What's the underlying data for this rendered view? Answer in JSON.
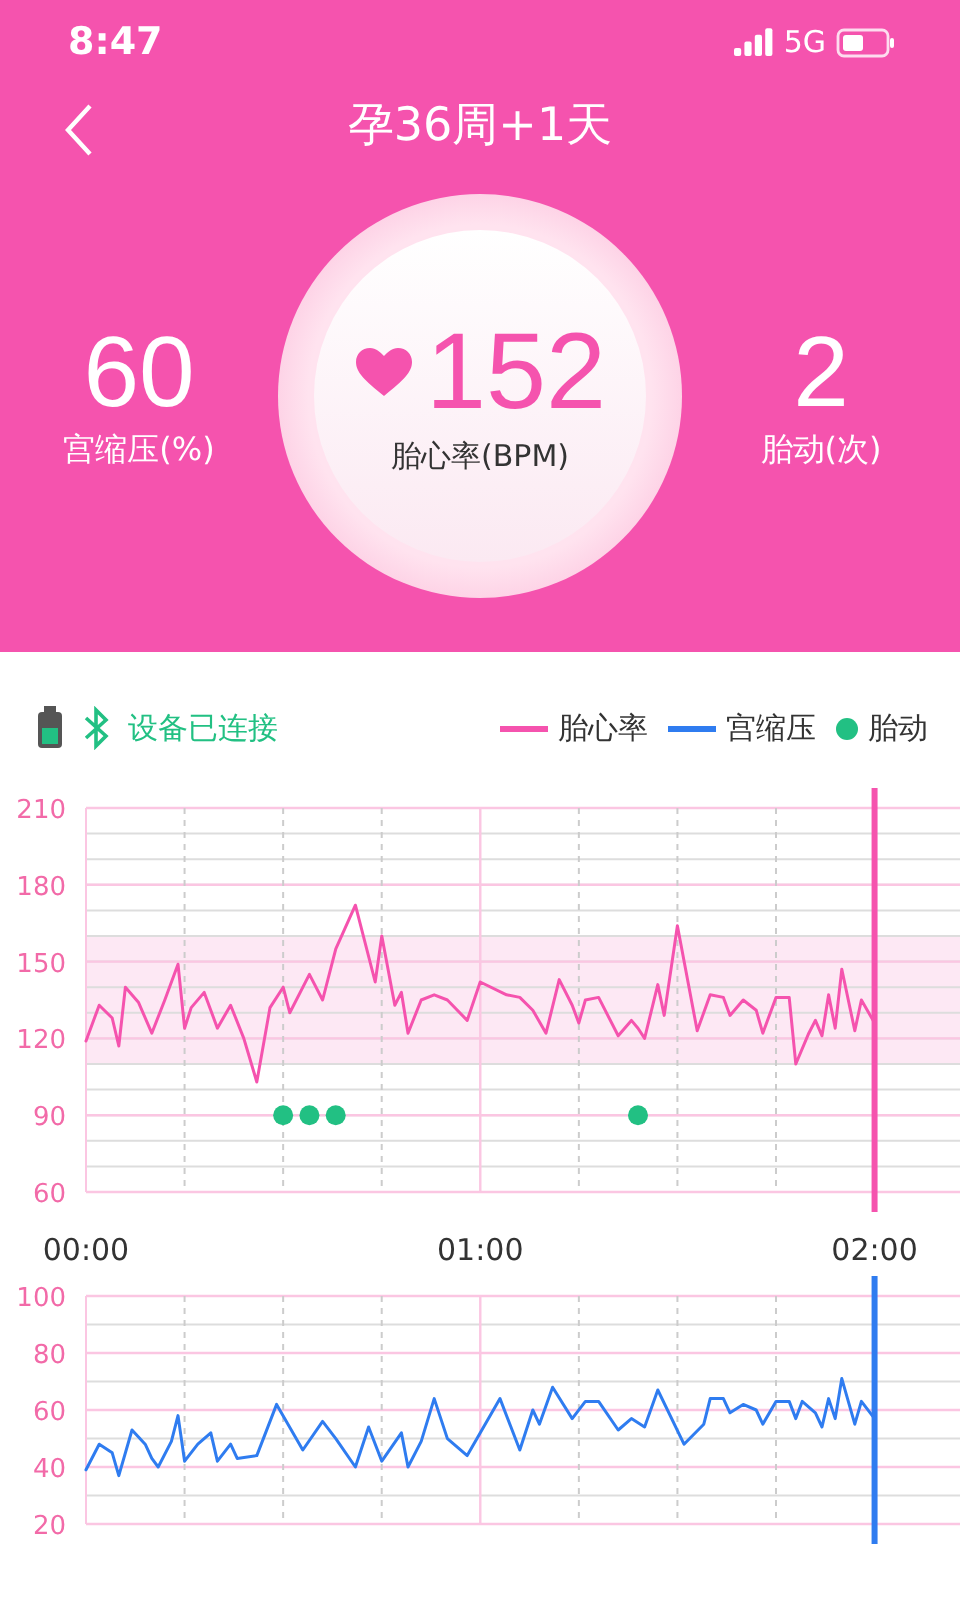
{
  "status_bar": {
    "time": "8:47",
    "network": "5G"
  },
  "header": {
    "title": "孕36周+1天"
  },
  "stats": [
    {
      "kind": "side",
      "value": "60",
      "label": "宫缩压(%)"
    },
    {
      "kind": "main",
      "value": "152",
      "label": "胎心率(BPM)"
    },
    {
      "kind": "side",
      "value": "2",
      "label": "胎动(次)"
    }
  ],
  "device": {
    "status": "设备已连接",
    "connected": true
  },
  "fhr_chart": {
    "chart_data": {
      "type": "line",
      "grid": true,
      "bands": [
        {
          "axis": "y",
          "from": 110,
          "to": 160,
          "color": "#fde8f4"
        }
      ],
      "ref_lines": [
        {
          "axis": "x",
          "value": 60,
          "color": "#fbc6e2"
        },
        {
          "axis": "x",
          "value": 120,
          "color": "#f553ae"
        }
      ],
      "xlim": [
        0,
        133
      ],
      "ylim": [
        60,
        210
      ],
      "yticks": [
        60,
        90,
        120,
        150,
        180,
        210
      ],
      "xticks": [
        {
          "value": 0,
          "label": "00:00"
        },
        {
          "value": 60,
          "label": "01:00"
        },
        {
          "value": 120,
          "label": "02:00"
        }
      ],
      "x": [
        0,
        2,
        4,
        5,
        6,
        8,
        10,
        12,
        14,
        15,
        16,
        18,
        20,
        22,
        24,
        26,
        28,
        30,
        31,
        34,
        36,
        38,
        41,
        44,
        45,
        47,
        48,
        49,
        51,
        53,
        55,
        58,
        60,
        64,
        66,
        68,
        70,
        72,
        74,
        75,
        76,
        78,
        81,
        83,
        84,
        85,
        87,
        88,
        90,
        93,
        95,
        97,
        98,
        100,
        102,
        103,
        105,
        107,
        108,
        110,
        111,
        112,
        113,
        114,
        115,
        117,
        118,
        120
      ],
      "series": [
        {
          "name": "胎心率",
          "color": "#f553ae",
          "values": [
            119,
            133,
            128,
            117,
            140,
            134,
            122,
            135,
            149,
            124,
            132,
            138,
            124,
            133,
            120,
            103,
            132,
            140,
            130,
            145,
            135,
            155,
            172,
            142,
            160,
            133,
            138,
            122,
            135,
            137,
            135,
            127,
            142,
            137,
            136,
            131,
            122,
            143,
            133,
            126,
            135,
            136,
            121,
            127,
            124,
            120,
            141,
            129,
            164,
            123,
            137,
            136,
            129,
            135,
            131,
            122,
            136,
            136,
            110,
            122,
            127,
            121,
            137,
            124,
            147,
            123,
            135,
            126
          ]
        },
        {
          "name": "胎动",
          "type": "scatter",
          "color": "#22c083",
          "values": [
            null,
            null,
            null,
            null,
            null,
            null,
            null,
            null,
            null,
            null,
            null,
            null,
            null,
            null,
            null,
            null,
            null,
            90,
            null,
            90,
            null,
            90,
            null,
            null,
            null,
            null,
            null,
            null,
            null,
            null,
            null,
            null,
            null,
            null,
            null,
            null,
            null,
            null,
            null,
            null,
            null,
            null,
            null,
            null,
            90,
            null,
            null,
            null,
            null,
            null,
            null,
            null,
            null,
            null,
            null,
            null,
            null,
            null,
            null,
            null,
            null,
            null,
            null,
            null,
            null,
            null,
            null,
            null
          ]
        }
      ]
    }
  },
  "toco_chart": {
    "chart_data": {
      "type": "line",
      "grid": true,
      "ref_lines": [
        {
          "axis": "x",
          "value": 60,
          "color": "#fbc6e2"
        },
        {
          "axis": "x",
          "value": 120,
          "color": "#2f7cf0"
        }
      ],
      "xlim": [
        0,
        133
      ],
      "ylim": [
        20,
        100
      ],
      "yticks": [
        20,
        40,
        60,
        80,
        100
      ],
      "x": [
        0,
        2,
        4,
        5,
        7,
        9,
        10,
        11,
        13,
        14,
        15,
        17,
        19,
        20,
        22,
        23,
        26,
        29,
        33,
        36,
        38,
        41,
        43,
        45,
        48,
        49,
        51,
        53,
        55,
        58,
        63,
        66,
        68,
        69,
        71,
        74,
        76,
        78,
        81,
        83,
        85,
        87,
        91,
        94,
        95,
        97,
        98,
        100,
        102,
        103,
        105,
        107,
        108,
        109,
        111,
        112,
        113,
        114,
        115,
        117,
        118,
        120
      ],
      "series": [
        {
          "name": "宫缩压",
          "color": "#2f7cf0",
          "values": [
            39,
            48,
            45,
            37,
            53,
            48,
            43,
            40,
            49,
            58,
            42,
            48,
            52,
            42,
            48,
            43,
            44,
            62,
            46,
            56,
            50,
            40,
            54,
            42,
            52,
            40,
            49,
            64,
            50,
            44,
            64,
            46,
            60,
            55,
            68,
            57,
            63,
            63,
            53,
            57,
            54,
            67,
            48,
            55,
            64,
            64,
            59,
            62,
            60,
            55,
            63,
            63,
            57,
            63,
            59,
            54,
            64,
            57,
            71,
            55,
            63,
            57
          ]
        }
      ]
    }
  }
}
